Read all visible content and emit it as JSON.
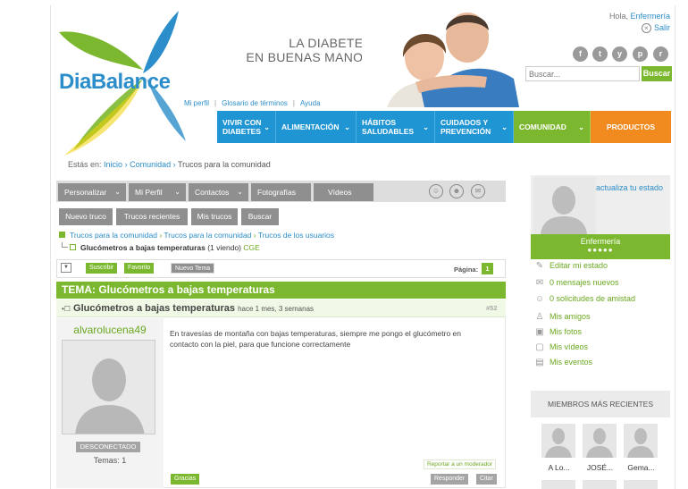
{
  "brand": {
    "part1": "Dia",
    "part2": "Balance"
  },
  "slogan": {
    "line1": "LA DIABETES",
    "line2": "EN BUENAS MANOS"
  },
  "user": {
    "greeting": "Hola,",
    "name": "Enfermería",
    "logout": "Salir"
  },
  "social": [
    "f",
    "t",
    "y",
    "p",
    "r"
  ],
  "search": {
    "placeholder": "Buscar...",
    "button": "Buscar"
  },
  "toplinks": [
    "Mi perfil",
    "Glosario de términos",
    "Ayuda"
  ],
  "nav": [
    {
      "label": "VIVIR CON DIABETES"
    },
    {
      "label": "ALIMENTACIÓN"
    },
    {
      "label": "HÁBITOS SALUDABLES"
    },
    {
      "label": "CUIDADOS Y PREVENCIÓN"
    },
    {
      "label": "COMUNIDAD"
    },
    {
      "label": "PRODUCTOS"
    }
  ],
  "breadcrumb": {
    "prefix": "Estás en:",
    "home": "Inicio",
    "section": "Comunidad",
    "current": "Trucos para la comunidad"
  },
  "tabs": [
    "Personalizar",
    "Mi Perfil",
    "Contactos",
    "Fotografías",
    "Vídeos"
  ],
  "subtabs": [
    "Nuevo truco",
    "Trucos recientes",
    "Mis trucos",
    "Buscar"
  ],
  "tree": {
    "l1": "Trucos para la comunidad",
    "l2": "Trucos para la comunidad",
    "l3": "Trucos de los usuarios",
    "topic": "Glucómetros a bajas temperaturas",
    "viewing": "(1 viendo)",
    "tag": "CGE"
  },
  "toolbar": {
    "subscribe": "Suscribir",
    "favorite": "Favorito",
    "new_topic": "Nuevo Tema",
    "page_label": "Página:",
    "page": "1"
  },
  "topic": {
    "bar": "TEMA: Glucómetros a bajas temperaturas",
    "title": "Glucómetros a bajas temperaturas",
    "ago": "hace 1 mes, 3 semanas",
    "number": "#52"
  },
  "post": {
    "author": "alvarolucena49",
    "status": "DESCONECTADO",
    "temas": "Temas: 1",
    "text": "En travesías de montaña con bajas temperaturas, siempre me pongo el glucómetro en contacto con la piel, para que funcione correctamente",
    "report": "Reportar a un moderador",
    "thanks": "Gracias",
    "reply": "Responder",
    "quote": "Citar"
  },
  "sidebar": {
    "update_status": "actualiza tu estado",
    "name": "Enfermería",
    "dots": "●●●●●",
    "edit_status": "Editar mi estado",
    "messages": "0 mensajes nuevos",
    "requests": "0 solicitudes de amistad",
    "friends": "Mis amigos",
    "photos": "Mis fotos",
    "videos": "Mis vídeos",
    "events": "Mis eventos",
    "members_title": "MIEMBROS MÁS RECIENTES",
    "members": [
      "A Lo...",
      "JOSÉ...",
      "Gema..."
    ]
  },
  "colors": {
    "green": "#7cb82f",
    "blue": "#1f95d3",
    "orange": "#f18b1f",
    "gray": "#8f8f8f"
  }
}
